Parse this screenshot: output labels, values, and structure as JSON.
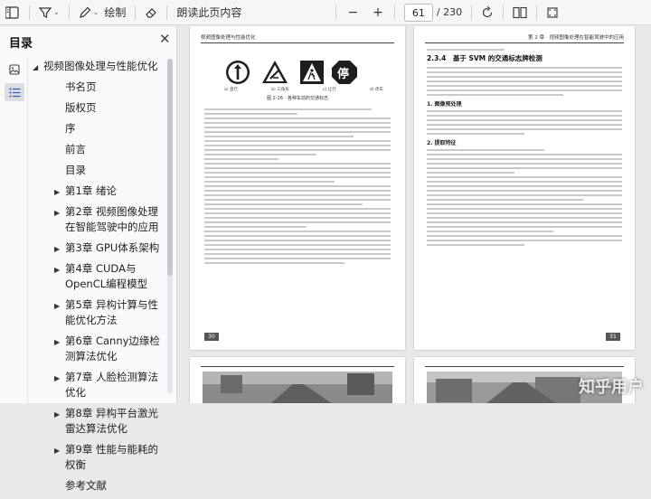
{
  "toolbar": {
    "draw_label": "绘制",
    "read_aloud_label": "朗读此页内容",
    "current_page": "61",
    "total_pages": "/ 230"
  },
  "sidebar": {
    "title": "目录",
    "items": [
      {
        "label": "视频图像处理与性能优化",
        "level": 0,
        "expand": "collapse"
      },
      {
        "label": "书名页",
        "level": 1,
        "expand": "none"
      },
      {
        "label": "版权页",
        "level": 1,
        "expand": "none"
      },
      {
        "label": "序",
        "level": 1,
        "expand": "none"
      },
      {
        "label": "前言",
        "level": 1,
        "expand": "none"
      },
      {
        "label": "目录",
        "level": 1,
        "expand": "none"
      },
      {
        "label": "第1章 绪论",
        "level": 1,
        "expand": "expand"
      },
      {
        "label": "第2章 视频图像处理在智能驾驶中的应用",
        "level": 1,
        "expand": "expand"
      },
      {
        "label": "第3章 GPU体系架构",
        "level": 1,
        "expand": "expand"
      },
      {
        "label": "第4章 CUDA与OpenCL编程模型",
        "level": 1,
        "expand": "expand"
      },
      {
        "label": "第5章 异构计算与性能优化方法",
        "level": 1,
        "expand": "expand"
      },
      {
        "label": "第6章 Canny边缘检测算法优化",
        "level": 1,
        "expand": "expand"
      },
      {
        "label": "第7章 人脸检测算法优化",
        "level": 1,
        "expand": "expand"
      },
      {
        "label": "第8章 异构平台激光雷达算法优化",
        "level": 1,
        "expand": "expand"
      },
      {
        "label": "第9章 性能与能耗的权衡",
        "level": 1,
        "expand": "expand"
      },
      {
        "label": "参考文献",
        "level": 1,
        "expand": "none"
      }
    ]
  },
  "pages": {
    "left": {
      "header": "视频图像处理与性能优化",
      "figure_caption": "图 2-16　各种车前的交通标志",
      "sign_labels": [
        "a) 直行",
        "b) 三角形",
        "c) 让行",
        "d) 停车"
      ],
      "sign_stop_text": "停",
      "page_number": "30"
    },
    "right": {
      "header": "第 2 章　视频图像处理在智能驾驶中的应用",
      "section_title": "2.3.4　基于 SVM 的交通标志牌检测",
      "sub1": "1. 图像预处理",
      "sub2": "2. 提取特征",
      "page_number": "31"
    }
  },
  "watermark": "知乎用户",
  "colors": {
    "toolbar_bg": "#f6f6f8",
    "sidebar_bg": "#fafafa",
    "canvas_bg": "#e9e9ec",
    "page_number_bg": "#555555"
  }
}
